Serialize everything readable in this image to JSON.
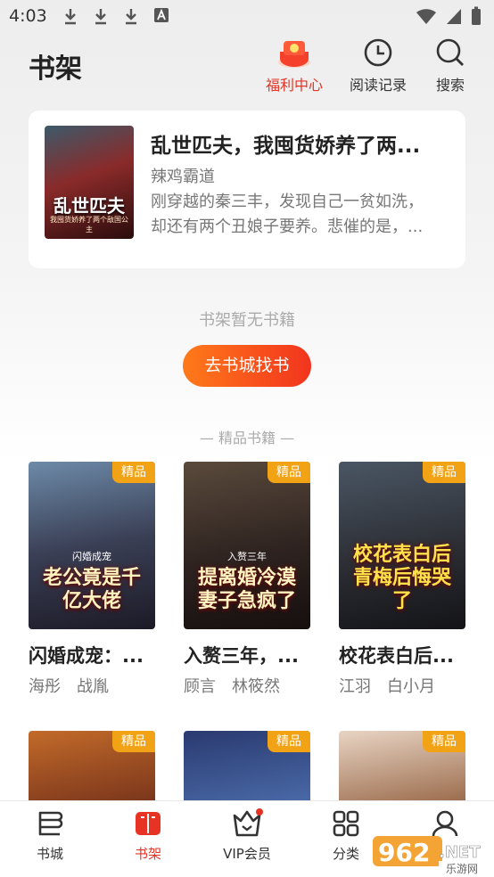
{
  "status": {
    "time": "4:03"
  },
  "header": {
    "title": "书架",
    "welfare_label": "福利中心",
    "history_label": "阅读记录",
    "search_label": "搜索"
  },
  "recent": {
    "title": "乱世匹夫，我囤货娇养了两...",
    "author": "辣鸡霸道",
    "desc_line1": "刚穿越的秦三丰，发现自己一贫如洗，",
    "desc_line2": "却还有两个丑娘子要养。悲催的是，...",
    "cover_title": "乱世匹夫",
    "cover_sub": "我囤货娇养了两个敌国公主"
  },
  "shelf": {
    "empty_text": "书架暂无书籍",
    "goto_label": "去书城找书",
    "section_label": "— 精品书籍 —"
  },
  "books": [
    {
      "badge": "精品",
      "title": "闪婚成宠：...",
      "authors": "海彤　战胤",
      "cover_text": "老公竟是千亿大佬",
      "cover_sub": "闪婚成宠"
    },
    {
      "badge": "精品",
      "title": "入赘三年，...",
      "authors": "顾言　林筱然",
      "cover_text": "提离婚冷漠妻子急疯了",
      "cover_sub": "入赘三年"
    },
    {
      "badge": "精品",
      "title": "校花表白后...",
      "authors": "江羽　白小月",
      "cover_text": "校花表白后青梅后悔哭了",
      "cover_sub": ""
    },
    {
      "badge": "精品"
    },
    {
      "badge": "精品"
    },
    {
      "badge": "精品"
    }
  ],
  "tabs": [
    {
      "label": "书城"
    },
    {
      "label": "书架"
    },
    {
      "label": "VIP会员"
    },
    {
      "label": "分类"
    },
    {
      "label": ""
    }
  ],
  "watermark": {
    "number": "962",
    "suffix": ".NET",
    "sub": "乐游网"
  },
  "colors": {
    "accent": "#e63324",
    "badge": "#f2a215",
    "button_from": "#ff7a1a",
    "button_to": "#f2341e"
  }
}
